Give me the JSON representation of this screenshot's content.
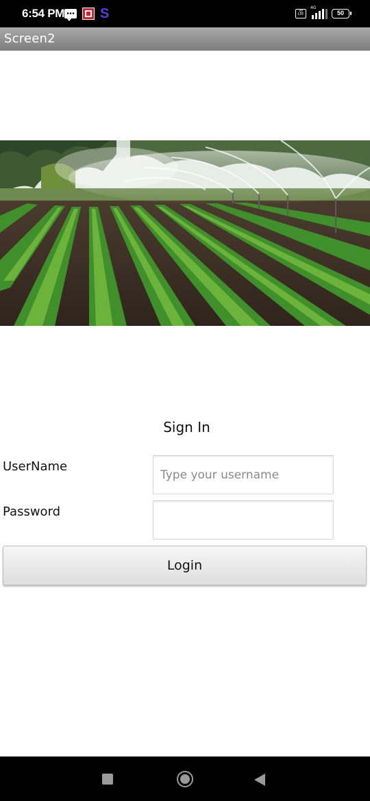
{
  "status_bar": {
    "time": "6:54 PM",
    "notification_icons": [
      "message-icon",
      "app-notification-icon",
      "s-app-icon"
    ],
    "s_app_glyph": "S",
    "system_icons": [
      "volte-icon",
      "signal-4g-icon",
      "battery-icon"
    ],
    "network_type": "4G",
    "battery_level": "50",
    "volte_text": "Vo LTE"
  },
  "app_bar": {
    "title": "Screen2"
  },
  "hero_image": {
    "description_icon": "farm-field-sprinkler-image"
  },
  "form": {
    "title": "Sign In",
    "username_label": "UserName",
    "username_placeholder": "Type your username",
    "username_value": "",
    "password_label": "Password",
    "password_value": "",
    "login_label": "Login"
  },
  "nav_bar": {
    "buttons": [
      "recent-apps-icon",
      "home-icon",
      "back-icon"
    ]
  },
  "colors": {
    "title_bar_top": "#a9a9a9",
    "title_bar_bottom": "#7d7d7d",
    "button_face": "#e9e9e9",
    "system_bar": "#000000"
  }
}
